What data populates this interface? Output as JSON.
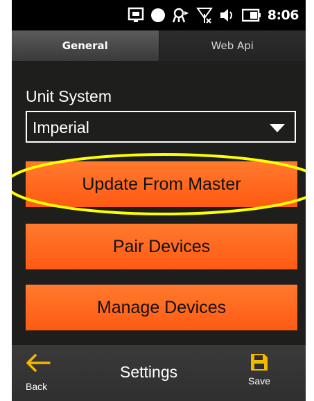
{
  "status_bar": {
    "time": "8:06",
    "icons": [
      "device-sync-icon",
      "record-dot-icon",
      "gps-icon",
      "no-signal-icon",
      "speaker-icon",
      "battery-icon"
    ]
  },
  "tabs": [
    {
      "label": "General",
      "active": true
    },
    {
      "label": "Web Api",
      "active": false
    }
  ],
  "settings": {
    "unit_system_label": "Unit System",
    "unit_system_value": "Imperial"
  },
  "buttons": {
    "update_from_master": "Update From Master",
    "pair_devices": "Pair Devices",
    "manage_devices": "Manage Devices"
  },
  "appbar": {
    "back_label": "Back",
    "title": "Settings",
    "save_label": "Save"
  },
  "colors": {
    "accent_orange": "#ff6a1f",
    "highlight_yellow": "#ffff00",
    "background": "#1e1f1c"
  }
}
